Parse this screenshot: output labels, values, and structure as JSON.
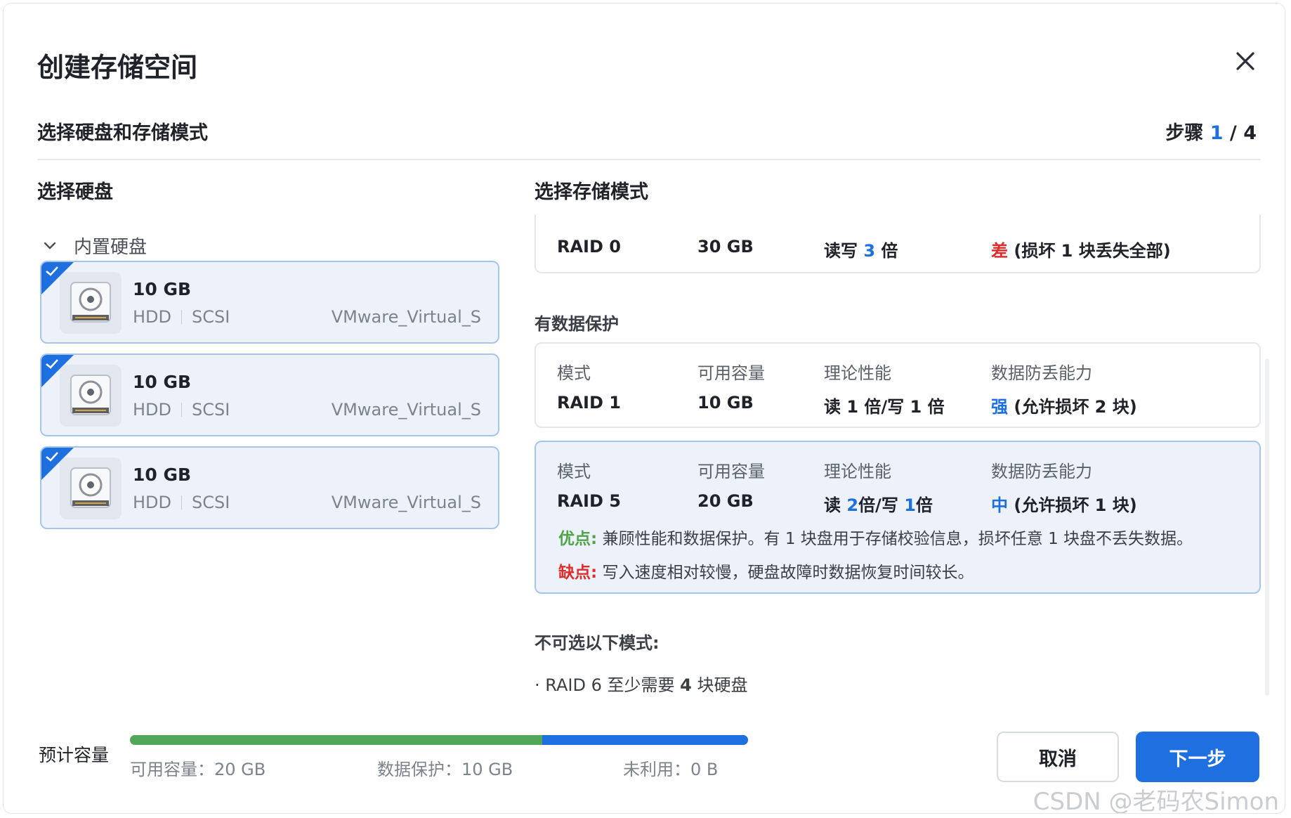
{
  "dialog": {
    "title": "创建存储空间",
    "subtitle": "选择硬盘和存储模式",
    "step": {
      "label": "步骤",
      "current": "1",
      "separator": "/",
      "total": "4"
    }
  },
  "left": {
    "section_title": "选择硬盘",
    "group_label": "内置硬盘",
    "disks": [
      {
        "size": "10 GB",
        "type": "HDD",
        "bus": "SCSI",
        "model": "VMware_Virtual_S",
        "selected": true
      },
      {
        "size": "10 GB",
        "type": "HDD",
        "bus": "SCSI",
        "model": "VMware_Virtual_S",
        "selected": true
      },
      {
        "size": "10 GB",
        "type": "HDD",
        "bus": "SCSI",
        "model": "VMware_Virtual_S",
        "selected": true
      }
    ]
  },
  "right": {
    "section_title": "选择存储模式",
    "headers": {
      "mode": "模式",
      "capacity": "可用容量",
      "performance": "理论性能",
      "protection": "数据防丢能力"
    },
    "raid0": {
      "mode": "RAID 0",
      "capacity": "30 GB",
      "perf_a": "读写",
      "perf_b": "3",
      "perf_c": "倍",
      "prot_level": "差",
      "prot_desc": "(损坏 1 块丢失全部)"
    },
    "protected_label": "有数据保护",
    "raid1": {
      "mode": "RAID 1",
      "capacity": "10 GB",
      "perf": "读 1 倍/写 1 倍",
      "prot_level": "强",
      "prot_desc": "(允许损坏 2 块)"
    },
    "raid5": {
      "mode": "RAID 5",
      "capacity": "20 GB",
      "perf_a": "读",
      "perf_b": "2",
      "perf_c": "倍/写",
      "perf_d": "1",
      "perf_e": "倍",
      "prot_level": "中",
      "prot_desc": "(允许损坏 1 块)",
      "pros_label": "优点:",
      "pros": "兼顾性能和数据保护。有 1 块盘用于存储校验信息，损坏任意 1 块盘不丢失数据。",
      "cons_label": "缺点:",
      "cons": "写入速度相对较慢，硬盘故障时数据恢复时间较长。",
      "selected": true
    },
    "unavailable_label": "不可选以下模式:",
    "unavailable": [
      {
        "prefix": "· RAID 6",
        "req_a": "至少需要",
        "req_n": "4",
        "req_b": "块硬盘"
      }
    ]
  },
  "footer": {
    "capacity_label": "预计容量",
    "usable_ratio": 0.667,
    "protection_ratio": 0.333,
    "unused_ratio": 0,
    "legend": {
      "usable": "可用容量：20 GB",
      "protection": "数据保护：10 GB",
      "unused": "未利用：0 B"
    },
    "cancel": "取消",
    "next": "下一步"
  },
  "watermark": "CSDN @老码农Simon",
  "colors": {
    "accent": "#1e6fe0",
    "usable": "#52a65a",
    "danger": "#e02b2b",
    "success": "#4ea447"
  },
  "icons": [
    "close-icon",
    "chevron-down-icon",
    "check-icon",
    "hdd-icon"
  ]
}
